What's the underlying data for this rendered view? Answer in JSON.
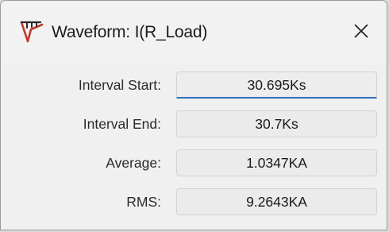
{
  "window": {
    "title": "Waveform: I(R_Load)",
    "icon": "ltspice-logo-icon",
    "close_label": "×"
  },
  "fields": [
    {
      "label": "Interval Start:",
      "value": "30.695Ks"
    },
    {
      "label": "Interval End:",
      "value": "30.7Ks"
    },
    {
      "label": "Average:",
      "value": "1.0347KA"
    },
    {
      "label": "RMS:",
      "value": "9.2643KA"
    }
  ],
  "colors": {
    "accent": "#2e6fbd",
    "icon_red": "#c0392b"
  }
}
